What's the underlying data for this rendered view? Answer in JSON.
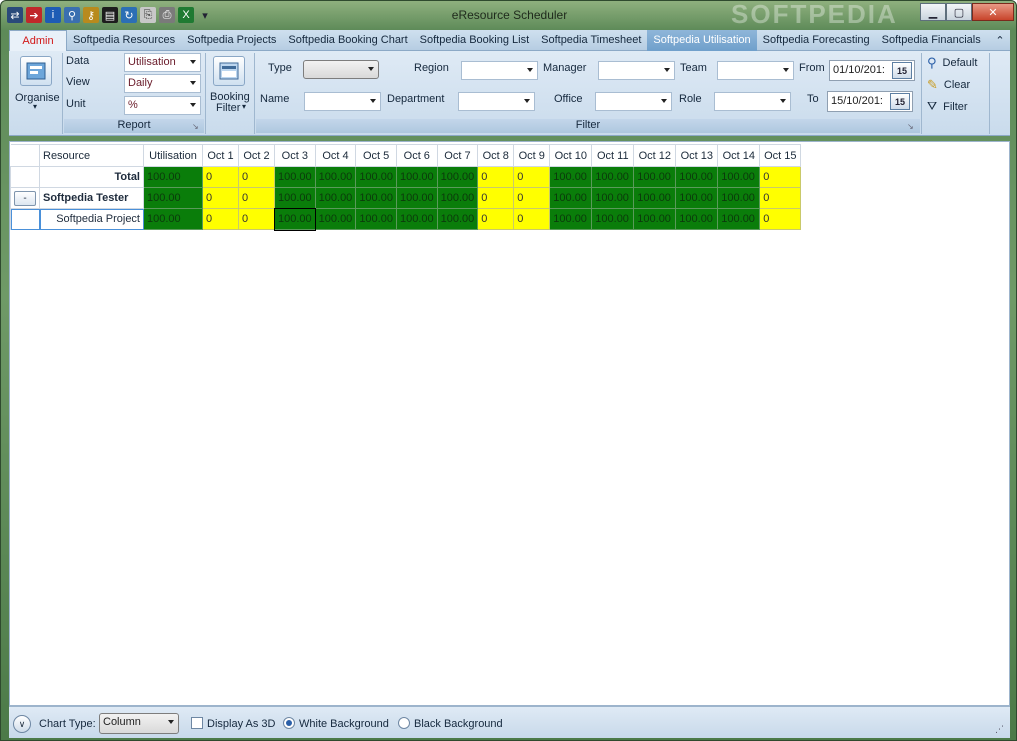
{
  "window": {
    "title": "eResource Scheduler",
    "watermark": "SOFTPEDIA"
  },
  "qat_icons": [
    "swap-icon",
    "exit-icon",
    "info-icon",
    "pin-icon",
    "key-icon",
    "terminal-icon",
    "refresh-icon",
    "copy-icon",
    "print-icon",
    "excel-icon",
    "dropdown-icon"
  ],
  "tabs": {
    "admin": "Admin",
    "items": [
      "Softpedia Resources",
      "Softpedia Projects",
      "Softpedia Booking Chart",
      "Softpedia Booking List",
      "Softpedia Timesheet",
      "Softpedia Utilisation",
      "Softpedia Forecasting",
      "Softpedia Financials"
    ],
    "active": "Softpedia Utilisation",
    "collapse_glyph": "⌃"
  },
  "ribbon": {
    "organise_label": "Organise",
    "report": {
      "label": "Report",
      "data_label": "Data",
      "data_value": "Utilisation",
      "view_label": "View",
      "view_value": "Daily",
      "unit_label": "Unit",
      "unit_value": "%"
    },
    "booking_filter_label": "Booking",
    "booking_filter_label2": "Filter",
    "filter": {
      "label": "Filter",
      "type_label": "Type",
      "name_label": "Name",
      "region_label": "Region",
      "department_label": "Department",
      "manager_label": "Manager",
      "office_label": "Office",
      "team_label": "Team",
      "role_label": "Role",
      "from_label": "From",
      "from_value": "01/10/201:",
      "to_label": "To",
      "to_value": "15/10/201:",
      "cal_glyph": "15"
    },
    "actions": {
      "default": "Default",
      "clear": "Clear",
      "filter": "Filter"
    }
  },
  "grid": {
    "headers": [
      "Resource",
      "Utilisation",
      "Oct 1",
      "Oct 2",
      "Oct 3",
      "Oct 4",
      "Oct 5",
      "Oct 6",
      "Oct 7",
      "Oct 8",
      "Oct 9",
      "Oct 10",
      "Oct 11",
      "Oct 12",
      "Oct 13",
      "Oct 14",
      "Oct 15"
    ],
    "rows": [
      {
        "name": "Total",
        "util": "100.00",
        "values": [
          "0",
          "0",
          "100.00",
          "100.00",
          "100.00",
          "100.00",
          "100.00",
          "0",
          "0",
          "100.00",
          "100.00",
          "100.00",
          "100.00",
          "100.00",
          "0"
        ]
      },
      {
        "name": "Softpedia Tester",
        "button": "-",
        "util": "100.00",
        "values": [
          "0",
          "0",
          "100.00",
          "100.00",
          "100.00",
          "100.00",
          "100.00",
          "0",
          "0",
          "100.00",
          "100.00",
          "100.00",
          "100.00",
          "100.00",
          "0"
        ]
      },
      {
        "name": "Softpedia Project",
        "util": "100.00",
        "values": [
          "0",
          "0",
          "100.00",
          "100.00",
          "100.00",
          "100.00",
          "100.00",
          "0",
          "0",
          "100.00",
          "100.00",
          "100.00",
          "100.00",
          "100.00",
          "0"
        ]
      }
    ],
    "colors": {
      "full": "#0a7d0a",
      "empty": "#ffff00"
    }
  },
  "statusbar": {
    "chart_type_label": "Chart Type:",
    "chart_type_value": "Column",
    "display_3d_label": "Display As 3D",
    "white_bg_label": "White Background",
    "black_bg_label": "Black Background",
    "expand_glyph": "∨"
  }
}
